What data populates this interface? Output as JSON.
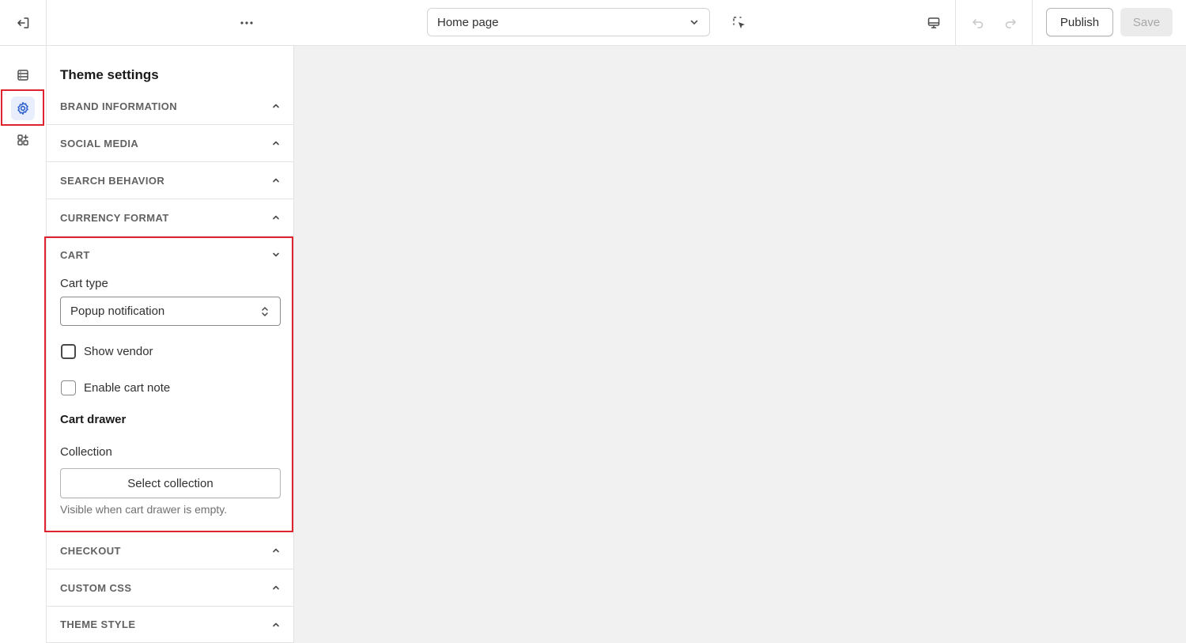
{
  "topbar": {
    "page_selector": "Home page",
    "publish_label": "Publish",
    "save_label": "Save",
    "icons": {
      "exit": "exit-icon",
      "more": "more-horizontal-icon",
      "inspect": "inspect-cursor-icon",
      "device": "desktop-icon",
      "undo": "undo-icon",
      "redo": "redo-icon"
    }
  },
  "rail": {
    "items": [
      {
        "name": "sections",
        "icon": "sections-icon"
      },
      {
        "name": "theme-settings",
        "icon": "gear-icon",
        "active": true
      },
      {
        "name": "apps",
        "icon": "apps-icon"
      }
    ]
  },
  "panel": {
    "title": "Theme settings",
    "sections_before": [
      {
        "label": "BRAND INFORMATION"
      },
      {
        "label": "SOCIAL MEDIA"
      },
      {
        "label": "SEARCH BEHAVIOR"
      },
      {
        "label": "CURRENCY FORMAT"
      }
    ],
    "cart": {
      "label": "CART",
      "cart_type_label": "Cart type",
      "cart_type_value": "Popup notification",
      "show_vendor_label": "Show vendor",
      "show_vendor_checked": false,
      "enable_cart_note_label": "Enable cart note",
      "enable_cart_note_checked": false,
      "cart_drawer_heading": "Cart drawer",
      "collection_label": "Collection",
      "select_collection_label": "Select collection",
      "help_text": "Visible when cart drawer is empty."
    },
    "sections_after": [
      {
        "label": "CHECKOUT"
      },
      {
        "label": "CUSTOM CSS"
      },
      {
        "label": "THEME STYLE"
      }
    ]
  },
  "colors": {
    "highlight": "#e0242f",
    "active_icon": "#2c5ecc",
    "active_bg": "#e8eefb"
  }
}
